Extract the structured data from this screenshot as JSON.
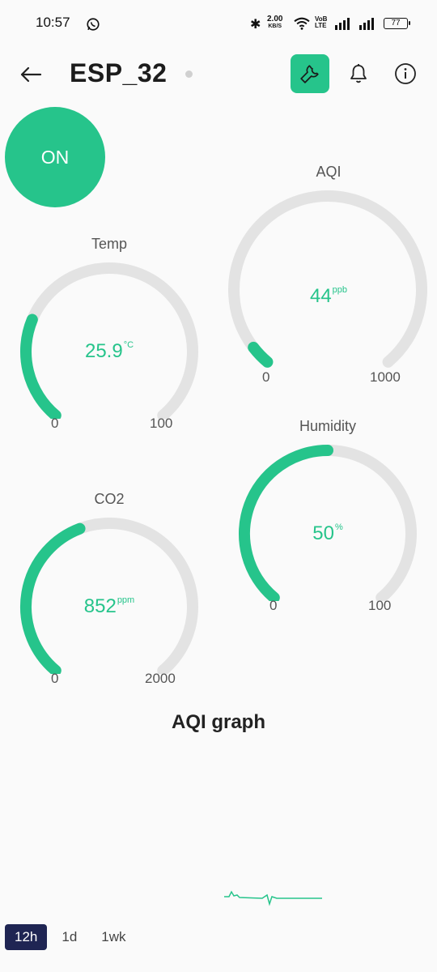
{
  "status_bar": {
    "time": "10:57",
    "net_speed": "2.00",
    "net_unit": "KB/S",
    "volte": "VoB LTE",
    "battery": "77"
  },
  "header": {
    "title": "ESP_32"
  },
  "power_button": {
    "label": "ON"
  },
  "accent_color": "#26c48b",
  "gauges": {
    "aqi": {
      "label": "AQI",
      "value": "44",
      "unit": "ppb",
      "min": "0",
      "max": "1000",
      "fraction": 0.044
    },
    "temp": {
      "label": "Temp",
      "value": "25.9",
      "unit": "°C",
      "min": "0",
      "max": "100",
      "fraction": 0.259
    },
    "humidity": {
      "label": "Humidity",
      "value": "50",
      "unit": "%",
      "min": "0",
      "max": "100",
      "fraction": 0.5
    },
    "co2": {
      "label": "CO2",
      "value": "852",
      "unit": "ppm",
      "min": "0",
      "max": "2000",
      "fraction": 0.426
    }
  },
  "graph": {
    "title": "AQI graph",
    "range_tabs": [
      "12h",
      "1d",
      "1wk"
    ],
    "selected_range": "12h"
  }
}
